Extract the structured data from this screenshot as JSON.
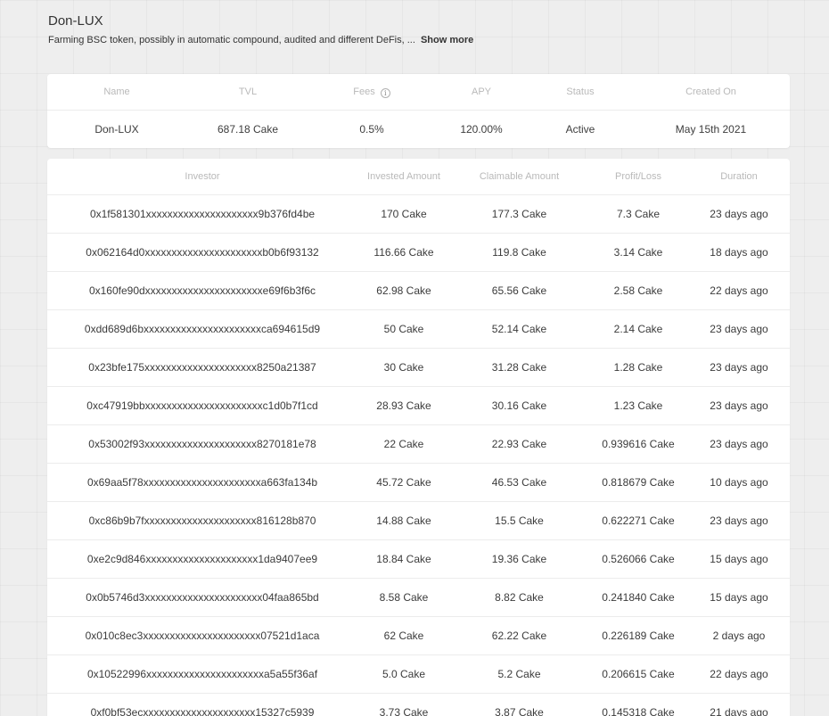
{
  "pool": {
    "title": "Don-LUX",
    "description": "Farming BSC token, possibly in automatic compound, audited and different DeFis, ...",
    "show_more": "Show more"
  },
  "summary": {
    "headers": {
      "name": "Name",
      "tvl": "TVL",
      "fees": "Fees",
      "apy": "APY",
      "status": "Status",
      "created": "Created On"
    },
    "values": {
      "name": "Don-LUX",
      "tvl": "687.18 Cake",
      "fees": "0.5%",
      "apy": "120.00%",
      "status": "Active",
      "created": "May 15th 2021"
    },
    "fees_info_icon": "info-icon"
  },
  "investors": {
    "headers": {
      "investor": "Investor",
      "invested": "Invested Amount",
      "claimable": "Claimable Amount",
      "profit": "Profit/Loss",
      "duration": "Duration"
    },
    "rows": [
      {
        "investor": "0x1f581301xxxxxxxxxxxxxxxxxxxxx9b376fd4be",
        "invested": "170 Cake",
        "claimable": "177.3 Cake",
        "profit": "7.3 Cake",
        "duration": "23 days ago"
      },
      {
        "investor": "0x062164d0xxxxxxxxxxxxxxxxxxxxxxb0b6f93132",
        "invested": "116.66 Cake",
        "claimable": "119.8 Cake",
        "profit": "3.14 Cake",
        "duration": "18 days ago"
      },
      {
        "investor": "0x160fe90dxxxxxxxxxxxxxxxxxxxxxxe69f6b3f6c",
        "invested": "62.98 Cake",
        "claimable": "65.56 Cake",
        "profit": "2.58 Cake",
        "duration": "22 days ago"
      },
      {
        "investor": "0xdd689d6bxxxxxxxxxxxxxxxxxxxxxxca694615d9",
        "invested": "50 Cake",
        "claimable": "52.14 Cake",
        "profit": "2.14 Cake",
        "duration": "23 days ago"
      },
      {
        "investor": "0x23bfe175xxxxxxxxxxxxxxxxxxxxx8250a21387",
        "invested": "30 Cake",
        "claimable": "31.28 Cake",
        "profit": "1.28 Cake",
        "duration": "23 days ago"
      },
      {
        "investor": "0xc47919bbxxxxxxxxxxxxxxxxxxxxxxc1d0b7f1cd",
        "invested": "28.93 Cake",
        "claimable": "30.16 Cake",
        "profit": "1.23 Cake",
        "duration": "23 days ago"
      },
      {
        "investor": "0x53002f93xxxxxxxxxxxxxxxxxxxxx8270181e78",
        "invested": "22 Cake",
        "claimable": "22.93 Cake",
        "profit": "0.939616 Cake",
        "duration": "23 days ago"
      },
      {
        "investor": "0x69aa5f78xxxxxxxxxxxxxxxxxxxxxxa663fa134b",
        "invested": "45.72 Cake",
        "claimable": "46.53 Cake",
        "profit": "0.818679 Cake",
        "duration": "10 days ago"
      },
      {
        "investor": "0xc86b9b7fxxxxxxxxxxxxxxxxxxxxx816128b870",
        "invested": "14.88 Cake",
        "claimable": "15.5 Cake",
        "profit": "0.622271 Cake",
        "duration": "23 days ago"
      },
      {
        "investor": "0xe2c9d846xxxxxxxxxxxxxxxxxxxxx1da9407ee9",
        "invested": "18.84 Cake",
        "claimable": "19.36 Cake",
        "profit": "0.526066 Cake",
        "duration": "15 days ago"
      },
      {
        "investor": "0x0b5746d3xxxxxxxxxxxxxxxxxxxxxx04faa865bd",
        "invested": "8.58 Cake",
        "claimable": "8.82 Cake",
        "profit": "0.241840 Cake",
        "duration": "15 days ago"
      },
      {
        "investor": "0x010c8ec3xxxxxxxxxxxxxxxxxxxxxx07521d1aca",
        "invested": "62 Cake",
        "claimable": "62.22 Cake",
        "profit": "0.226189 Cake",
        "duration": "2 days ago"
      },
      {
        "investor": "0x10522996xxxxxxxxxxxxxxxxxxxxxxa5a55f36af",
        "invested": "5.0 Cake",
        "claimable": "5.2 Cake",
        "profit": "0.206615 Cake",
        "duration": "22 days ago"
      },
      {
        "investor": "0xf0bf53ecxxxxxxxxxxxxxxxxxxxxx15327c5939",
        "invested": "3.73 Cake",
        "claimable": "3.87 Cake",
        "profit": "0.145318 Cake",
        "duration": "21 days ago"
      }
    ]
  }
}
